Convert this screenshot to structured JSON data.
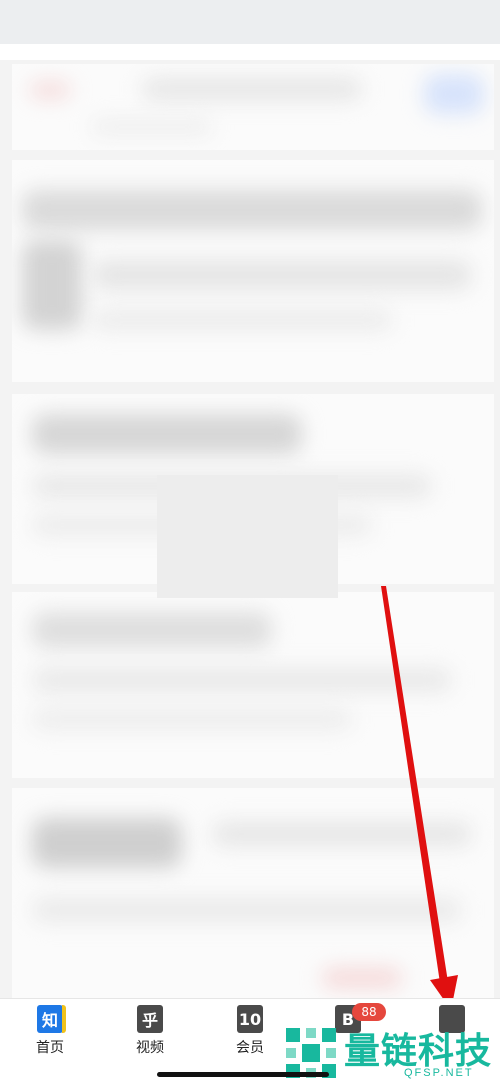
{
  "tabs": [
    {
      "label": "首页",
      "icon_char": "知",
      "icon": "zhihu-home-icon"
    },
    {
      "label": "视频",
      "icon_char": "乎",
      "icon": "video-icon"
    },
    {
      "label": "会员",
      "icon_char": "10",
      "icon": "membership-icon"
    },
    {
      "label": "",
      "icon_char": "B",
      "icon": "messages-icon",
      "badge": "88"
    },
    {
      "label": "",
      "icon_char": "",
      "icon": "profile-icon"
    }
  ],
  "watermark": {
    "text": "量链科技",
    "sub": "QFSP.NET"
  },
  "colors": {
    "arrow": "#e01010",
    "watermark": "#18b89e",
    "badge": "#e5473d",
    "home_icon": "#1e78e6"
  }
}
